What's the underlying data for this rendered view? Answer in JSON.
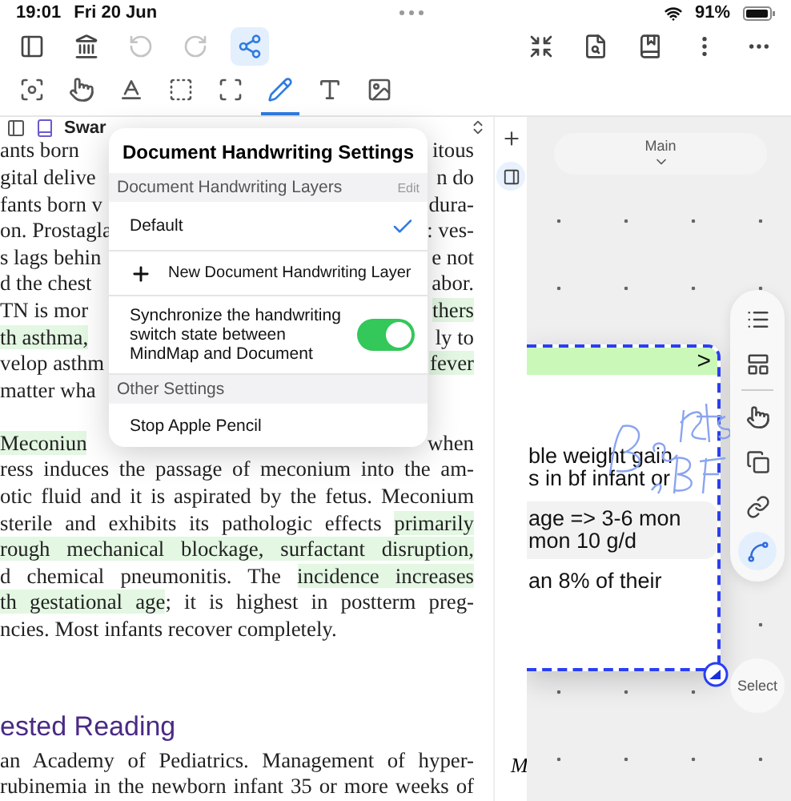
{
  "status_bar": {
    "time": "19:01",
    "date": "Fri 20 Jun",
    "battery": "91%"
  },
  "main_toolbar": [
    {
      "disabled": false,
      "selected": false
    },
    {
      "disabled": false,
      "selected": false
    },
    {
      "disabled": true,
      "selected": false
    },
    {
      "disabled": true,
      "selected": false
    },
    {
      "disabled": false,
      "selected": true
    }
  ],
  "tool_tabs": [
    {
      "selected": false
    },
    {
      "selected": false
    },
    {
      "selected": false
    },
    {
      "selected": false
    },
    {
      "selected": false
    },
    {
      "selected": true
    },
    {
      "selected": false
    },
    {
      "selected": false
    }
  ],
  "document": {
    "title": "Swar",
    "lines": [
      {
        "left": [
          {
            "text": "ants born",
            "hl": false
          }
        ],
        "right": [
          {
            "text": "itous",
            "hl": false
          }
        ]
      },
      {
        "left": [
          {
            "text": "gital delive",
            "hl": false
          }
        ],
        "right": [
          {
            "text": "n do",
            "hl": false
          }
        ]
      },
      {
        "left": [
          {
            "text": "fants born v",
            "hl": false
          }
        ],
        "right": [
          {
            "text": "dura-",
            "hl": false
          }
        ]
      },
      {
        "left": [
          {
            "text": "on. Prostagla",
            "hl": false
          }
        ],
        "right": [
          {
            "text": ": ves-",
            "hl": false
          }
        ]
      },
      {
        "left": [
          {
            "text": "s lags behin",
            "hl": false
          }
        ],
        "right": [
          {
            "text": "e not",
            "hl": false
          }
        ]
      },
      {
        "left": [
          {
            "text": "d the chest",
            "hl": false
          }
        ],
        "right": [
          {
            "text": "abor.",
            "hl": false
          }
        ]
      },
      {
        "left": [
          {
            "text": "TN is mor",
            "hl": false
          }
        ],
        "right": [
          {
            "text": "thers",
            "hl": true
          }
        ]
      },
      {
        "left": [
          {
            "text": "th asthma,",
            "hl": true
          }
        ],
        "right": [
          {
            "text": "ly to",
            "hl": false
          }
        ]
      },
      {
        "left": [
          {
            "text": "velop asthm",
            "hl": false
          }
        ],
        "right": [
          {
            "text": "fever",
            "hl": true
          }
        ]
      },
      {
        "left": [
          {
            "text": "matter wha",
            "hl": false
          }
        ]
      },
      {
        "new_paragraph": true,
        "left": [
          {
            "text": "Meconiun",
            "hl": true
          }
        ],
        "right": [
          {
            "text": "when",
            "hl": false
          }
        ]
      },
      {
        "full": [
          {
            "text": "ress induces the passage of meconium into the am-",
            "hl": false
          }
        ]
      },
      {
        "full": [
          {
            "text": "otic fluid and it is aspirated by the fetus. Meconium",
            "hl": false
          }
        ]
      },
      {
        "full": [
          {
            "text": "sterile and exhibits its pathologic effects ",
            "hl": false
          },
          {
            "text": "primarily",
            "hl": true
          }
        ]
      },
      {
        "full": [
          {
            "text": "rough mechanical blockage, surfactant disruption,",
            "hl": true
          }
        ]
      },
      {
        "full": [
          {
            "text": "d chemical pneumonitis. The ",
            "hl": false
          },
          {
            "text": "incidence increases",
            "hl": true
          }
        ]
      },
      {
        "full": [
          {
            "text": "th gestational age",
            "hl": true
          },
          {
            "text": "; it is highest in postterm preg-",
            "hl": false
          }
        ]
      },
      {
        "left": [
          {
            "text": "ncies. Most infants recover completely.",
            "hl": false
          }
        ]
      }
    ],
    "heading": "ested Reading",
    "lines2": [
      "an Academy of Pediatrics. Management of hyper-",
      "rubinemia in the newborn infant 35 or more weeks of"
    ],
    "edge_letter": "M"
  },
  "popover": {
    "title": "Document Handwriting Settings",
    "layers_header": "Document Handwriting Layers",
    "edit": "Edit",
    "layers": [
      {
        "name": "Default",
        "selected": true
      }
    ],
    "new_layer": "New Document Handwriting Layer",
    "sync": {
      "label": "Synchronize the handwriting switch state between MindMap and Document",
      "on": true
    },
    "other_header": "Other Settings",
    "stop": "Stop Apple Pencil"
  },
  "canvas": {
    "map_name": "Main",
    "card": {
      "arrow": ">",
      "lines": [
        "ble weight gain",
        "s in bf infant or"
      ],
      "box_lines": [
        "age => 3-6 mon",
        "mon 10 g/d"
      ],
      "tail": "an 8% of their"
    },
    "tools": [
      {
        "selected": false
      },
      {
        "selected": false
      },
      {
        "selected": false
      },
      {
        "selected": false
      },
      {
        "selected": false
      },
      {
        "selected": true
      }
    ],
    "select": "Select"
  }
}
